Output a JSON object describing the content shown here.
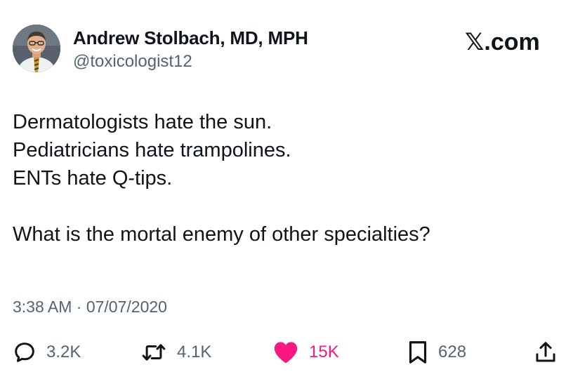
{
  "author": {
    "display_name": "Andrew Stolbach, MD, MPH",
    "handle": "@toxicologist12"
  },
  "brand": {
    "x_glyph": "𝕏",
    "suffix": ".com"
  },
  "tweet": {
    "lines": [
      "Dermatologists hate the sun.",
      "Pediatricians hate trampolines.",
      "ENTs hate Q-tips.",
      "",
      "What is the mortal enemy of other specialties?"
    ],
    "timestamp": "3:38 AM · 07/07/2020"
  },
  "actions": {
    "replies": "3.2K",
    "reposts": "4.1K",
    "likes": "15K",
    "bookmarks": "628"
  },
  "icons": {
    "reply": "reply-bubble-icon",
    "repost": "repost-arrows-icon",
    "like": "heart-icon",
    "bookmark": "bookmark-icon",
    "share": "share-upload-icon"
  },
  "colors": {
    "text": "#0f1419",
    "secondary": "#536471",
    "like": "#f91880",
    "background": "#ffffff"
  }
}
